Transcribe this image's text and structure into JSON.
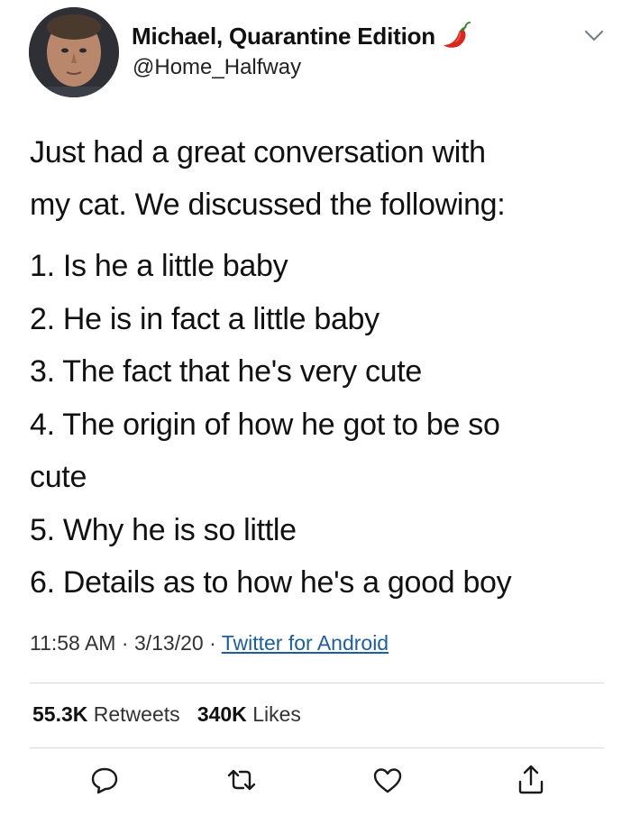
{
  "tweet": {
    "author": {
      "display_name": "Michael, Quarantine Edition",
      "handle": "@Home_Halfway"
    },
    "intro_lines": [
      "Just had a great conversation with",
      "my cat. We discussed the following:"
    ],
    "list_lines": [
      "1. Is he a little baby",
      "2. He is in fact a little baby",
      "3. The fact that he's very cute",
      "4. The origin of how he got to be so",
      "cute",
      "5. Why he is so little",
      "6. Details as to how he's a good boy"
    ],
    "meta": {
      "time": "11:58 AM",
      "separator": "·",
      "date": "3/13/20",
      "source": "Twitter for Android"
    },
    "stats": {
      "retweets_count": "55.3K",
      "retweets_label": "Retweets",
      "likes_count": "340K",
      "likes_label": "Likes"
    }
  },
  "icons": {
    "name_emoji": "chili-pepper-icon",
    "menu": "chevron-down-icon",
    "actions": [
      "reply-icon",
      "retweet-icon",
      "like-icon",
      "share-icon"
    ]
  },
  "colors": {
    "text": "#111111",
    "link": "#1c5e9e",
    "divider": "#d6d9db",
    "pepper_red": "#d8271c",
    "pepper_stem": "#3a8a2c"
  }
}
